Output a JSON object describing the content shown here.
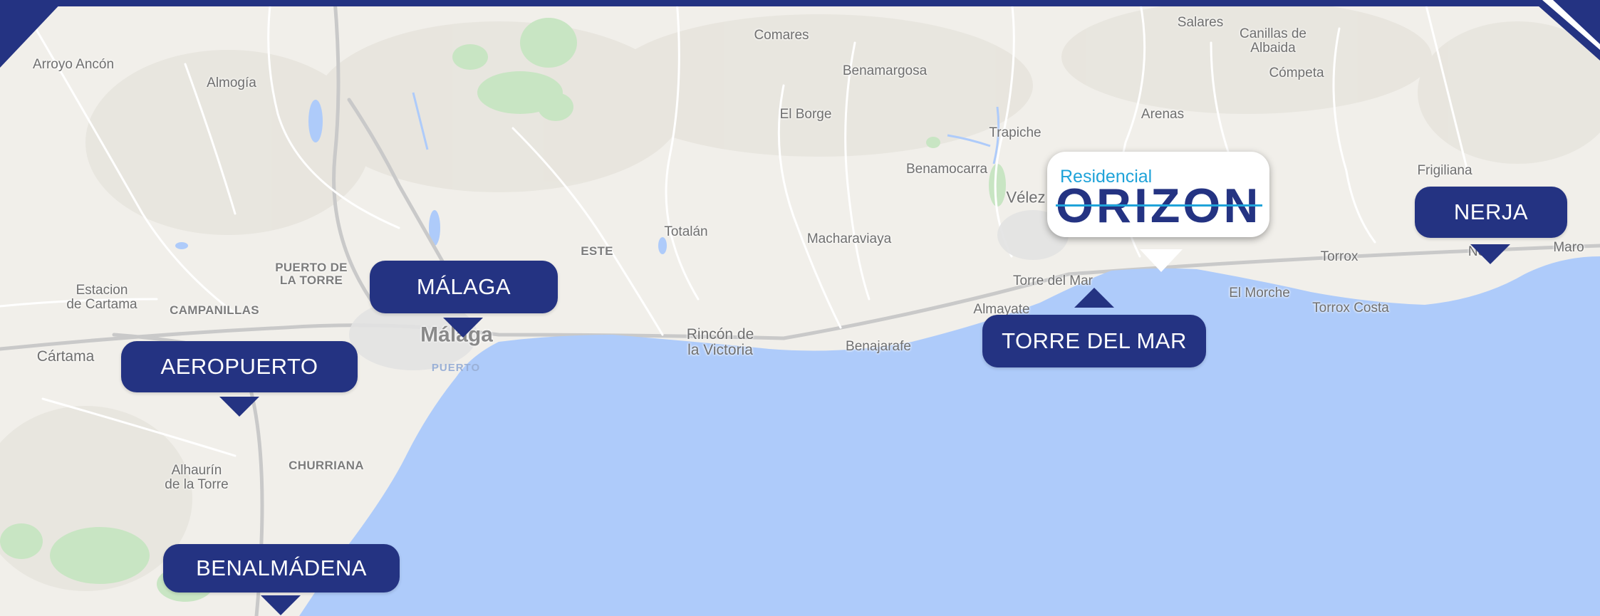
{
  "map": {
    "colors": {
      "land": "#f1efea",
      "sea": "#aecbfa",
      "brand_navy": "#243382",
      "brand_cyan": "#1fa3d9",
      "label_text": "#ffffff"
    },
    "place_labels": {
      "arroyo_ancon": "Arroyo Ancón",
      "almogia": "Almogía",
      "comares": "Comares",
      "benamargosa": "Benamargosa",
      "el_borge": "El Borge",
      "salares": "Salares",
      "canillas_de_albaida": "Canillas de\nAlbaida",
      "competa": "Cómpeta",
      "arenas": "Arenas",
      "trapiche": "Trapiche",
      "benamocarra": "Benamocarra",
      "velez": "Vélez",
      "frigiliana": "Frigiliana",
      "estacion_de_cartama": "Estacion\nde Cartama",
      "puerto_de_la_torre": "PUERTO DE\nLA TORRE",
      "campanillas": "CAMPANILLAS",
      "este": "ESTE",
      "totalan": "Totalán",
      "macharaviaya": "Macharaviaya",
      "malaga_city": "Málaga",
      "puerto": "PUERTO",
      "cartama": "Cártama",
      "rincon_de_la_victoria": "Rincón de\nla Victoria",
      "benajarafe": "Benajarafe",
      "almayate": "Almayate",
      "torre_del_mar_map": "Torre del Mar",
      "el_morche": "El Morche",
      "torrox": "Torrox",
      "torrox_costa": "Torrox Costa",
      "maro": "Maro",
      "nerja_map": "Ne",
      "alhaurin_de_la_torre": "Alhaurín\nde la Torre",
      "churriana": "CHURRIANA"
    },
    "markers": {
      "malaga": "MÁLAGA",
      "aeropuerto": "AEROPUERTO",
      "benalmadena": "BENALMÁDENA",
      "torre_del_mar": "TORRE DEL MAR",
      "nerja": "NERJA"
    },
    "logo": {
      "small": "Residencial",
      "big": "ORIZON"
    }
  }
}
